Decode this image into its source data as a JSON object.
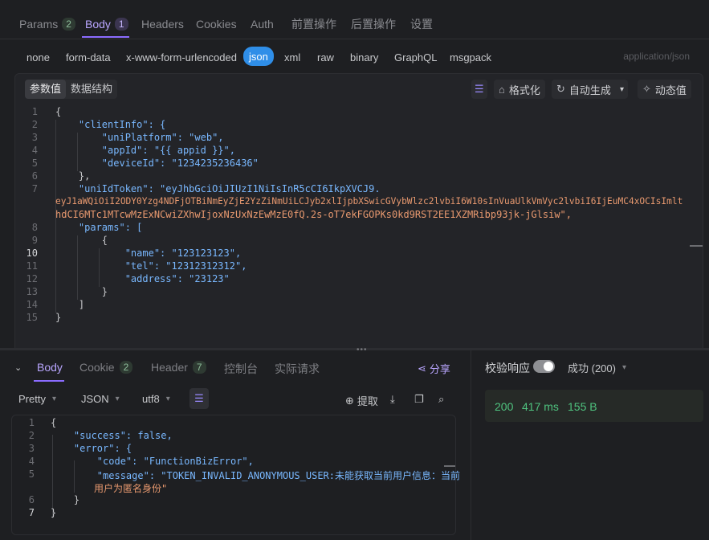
{
  "top_tabs": [
    {
      "label": "Params",
      "count": "2"
    },
    {
      "label": "Body",
      "count": "1"
    },
    {
      "label": "Headers"
    },
    {
      "label": "Cookies"
    },
    {
      "label": "Auth"
    },
    {
      "label": "前置操作"
    },
    {
      "label": "后置操作"
    },
    {
      "label": "设置"
    }
  ],
  "body_types": [
    "none",
    "form-data",
    "x-www-form-urlencoded",
    "json",
    "xml",
    "raw",
    "binary",
    "GraphQL",
    "msgpack"
  ],
  "content_type": "application/json",
  "editor": {
    "seg_params": "参数值",
    "seg_schema": "数据结构",
    "format_label": "格式化",
    "autogen_label": "自动生成",
    "dynamic_label": "动态值"
  },
  "request_lines": [
    {
      "n": "1",
      "t": "{"
    },
    {
      "n": "2",
      "t": "    \"clientInfo\": {"
    },
    {
      "n": "3",
      "t": "        \"uniPlatform\": \"web\","
    },
    {
      "n": "4",
      "t": "        \"appId\": \"{{ appid }}\","
    },
    {
      "n": "5",
      "t": "        \"deviceId\": \"1234235236436\""
    },
    {
      "n": "6",
      "t": "    },"
    },
    {
      "n": "7",
      "t": "    \"uniIdToken\": \"eyJhbGciOiJIUzI1NiIsInR5cCI6IkpXVCJ9."
    },
    {
      "n": "",
      "t": "eyJ1aWQiOiI2ODY0Yzg4NDFjOTBiNmEyZjE2YzZiNmUiLCJyb2xlIjpbXSwicGVybWlzc2lvbiI6W10sInVuaUlkVmVyc2lvbiI6IjEuMC4xOCIsImlhdCI6MTc1MTcwMzExNCwiZXhwIjoxNzUxNzEwMzE0fQ.2s-oT7ekFGOPKs0kd9RST2EE1XZMRibp93jk-jGlsiw\","
    },
    {
      "n": "8",
      "t": "    \"params\": ["
    },
    {
      "n": "9",
      "t": "        {"
    },
    {
      "n": "10",
      "t": "            \"name\": \"123123123\","
    },
    {
      "n": "11",
      "t": "            \"tel\": \"12312312312\","
    },
    {
      "n": "12",
      "t": "            \"address\": \"23123\""
    },
    {
      "n": "13",
      "t": "        }"
    },
    {
      "n": "14",
      "t": "    ]"
    },
    {
      "n": "15",
      "t": "}"
    }
  ],
  "token_wrap_1": "eyJ1aWQiOiI2ODY0Yzg4NDFjOTBiNmEyZjE2YzZiNmUiLCJyb2xlIjpbXSwicGVybWlzc2lvbiI6W10sInVuaUlkVmVyc2lvbiI6IjEuMC4xOCIsImlt",
  "token_wrap_2": "hdCI6MTc1MTcwMzExNCwiZXhwIjoxNzUxNzEwMzE0fQ.2s-oT7ekFGOPKs0kd9RST2EE1XZMRibp93jk-jGlsiw\",",
  "response_tabs": [
    {
      "label": "Body"
    },
    {
      "label": "Cookie",
      "count": "2"
    },
    {
      "label": "Header",
      "count": "7"
    },
    {
      "label": "控制台"
    },
    {
      "label": "实际请求"
    }
  ],
  "share_label": "分享",
  "resp_toolbar": {
    "view": "Pretty",
    "lang": "JSON",
    "encoding": "utf8",
    "extract": "提取"
  },
  "response_lines": [
    {
      "n": "1",
      "t": "{"
    },
    {
      "n": "2",
      "t": "    \"success\": false,"
    },
    {
      "n": "3",
      "t": "    \"error\": {"
    },
    {
      "n": "4",
      "t": "        \"code\": \"FunctionBizError\","
    },
    {
      "n": "5",
      "t": "        \"message\": \"TOKEN_INVALID_ANONYMOUS_USER:未能获取当前用户信息：当前"
    },
    {
      "n": "",
      "t": "用户为匿名身份\""
    },
    {
      "n": "6",
      "t": "    }"
    },
    {
      "n": "7",
      "t": "}"
    }
  ],
  "validate_label": "校验响应",
  "status_label": "成功 (200)",
  "stats": {
    "code": "200",
    "time": "417 ms",
    "size": "155 B"
  }
}
